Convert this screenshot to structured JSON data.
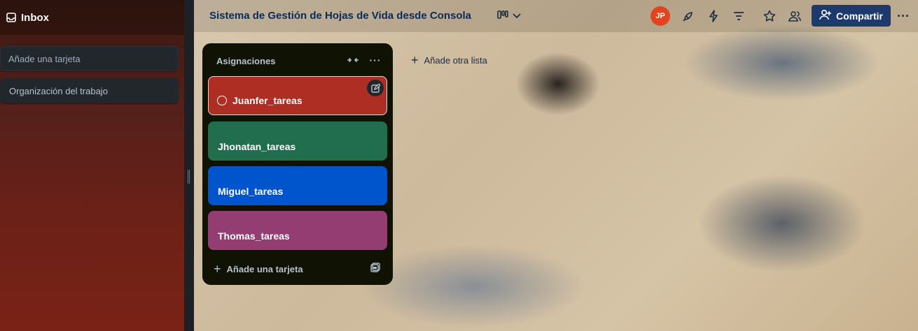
{
  "inbox": {
    "title": "Inbox",
    "add_card_placeholder": "Añade una tarjeta",
    "cards": [
      "Organización del trabajo"
    ]
  },
  "board": {
    "title": "Sistema de Gestión de Hojas de Vida desde Consola",
    "avatar_initials": "JP",
    "share_label": "Compartir",
    "add_list_label": "Añade otra lista"
  },
  "list": {
    "title": "Asignaciones",
    "cards": [
      {
        "label": "Juanfer_tareas",
        "color": "#ae2e24"
      },
      {
        "label": "Jhonatan_tareas",
        "color": "#216e4e"
      },
      {
        "label": "Miguel_tareas",
        "color": "#0055cc"
      },
      {
        "label": "Thomas_tareas",
        "color": "#943d73"
      }
    ],
    "add_card_label": "Añade una tarjeta"
  },
  "colors": {
    "header_title": "#0c2a5a",
    "share_button": "#1c3a6e",
    "avatar": "#e0451f",
    "list_bg": "#101204"
  },
  "icons": [
    "inbox-icon",
    "views-icon",
    "chevron-down-icon",
    "rocket-icon",
    "bolt-icon",
    "filter-icon",
    "star-icon",
    "team-icon",
    "add-person-icon",
    "more-icon",
    "collapse-icon",
    "edit-icon",
    "plus-icon",
    "template-icon"
  ]
}
